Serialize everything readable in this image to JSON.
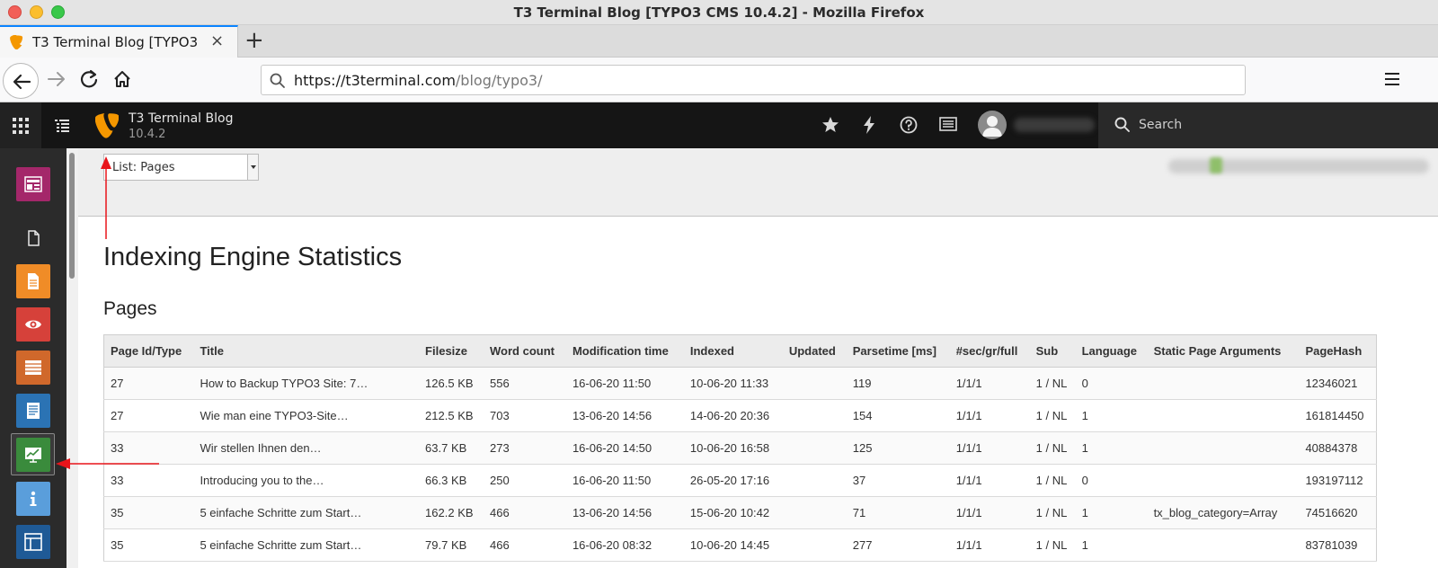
{
  "window": {
    "title": "T3 Terminal Blog [TYPO3 CMS 10.4.2] - Mozilla Firefox"
  },
  "browser": {
    "tab_title": "T3 Terminal Blog [TYPO3",
    "tab_close": "×",
    "new_tab": "+",
    "url_host": "https://t3terminal.com",
    "url_path": "/blog/typo3/"
  },
  "typo3": {
    "site_name": "T3 Terminal Blog",
    "version": "10.4.2",
    "search_label": "Search"
  },
  "docheader": {
    "function_select": "List: Pages"
  },
  "content": {
    "page_title": "Indexing Engine Statistics",
    "section_title": "Pages"
  },
  "table": {
    "columns": [
      "Page Id/Type",
      "Title",
      "Filesize",
      "Word count",
      "Modification time",
      "Indexed",
      "Updated",
      "Parsetime [ms]",
      "#sec/gr/full",
      "Sub",
      "Language",
      "Static Page Arguments",
      "PageHash"
    ],
    "rows": [
      [
        "27",
        "How to Backup TYPO3 Site: 7…",
        "126.5 KB",
        "556",
        "16-06-20 11:50",
        "10-06-20 11:33",
        "",
        "119",
        "1/1/1",
        "1 / NL",
        "0",
        "",
        "12346021"
      ],
      [
        "27",
        "Wie man eine TYPO3-Site…",
        "212.5 KB",
        "703",
        "13-06-20 14:56",
        "14-06-20 20:36",
        "",
        "154",
        "1/1/1",
        "1 / NL",
        "1",
        "",
        "161814450"
      ],
      [
        "33",
        "Wir stellen Ihnen den…",
        "63.7 KB",
        "273",
        "16-06-20 14:50",
        "10-06-20 16:58",
        "",
        "125",
        "1/1/1",
        "1 / NL",
        "1",
        "",
        "40884378"
      ],
      [
        "33",
        "Introducing you to the…",
        "66.3 KB",
        "250",
        "16-06-20 11:50",
        "26-05-20 17:16",
        "",
        "37",
        "1/1/1",
        "1 / NL",
        "0",
        "",
        "193197112"
      ],
      [
        "35",
        "5 einfache Schritte zum Start…",
        "162.2 KB",
        "466",
        "13-06-20 14:56",
        "15-06-20 10:42",
        "",
        "71",
        "1/1/1",
        "1 / NL",
        "1",
        "tx_blog_category=Array",
        "74516620"
      ],
      [
        "35",
        "5 einfache Schritte zum Start…",
        "79.7 KB",
        "466",
        "16-06-20 08:32",
        "10-06-20 14:45",
        "",
        "277",
        "1/1/1",
        "1 / NL",
        "1",
        "",
        "83781039"
      ]
    ]
  },
  "colors": {
    "typo3_orange": "#f49700",
    "annotation_red": "#e8141a",
    "firefox_blue": "#0a84ff"
  }
}
